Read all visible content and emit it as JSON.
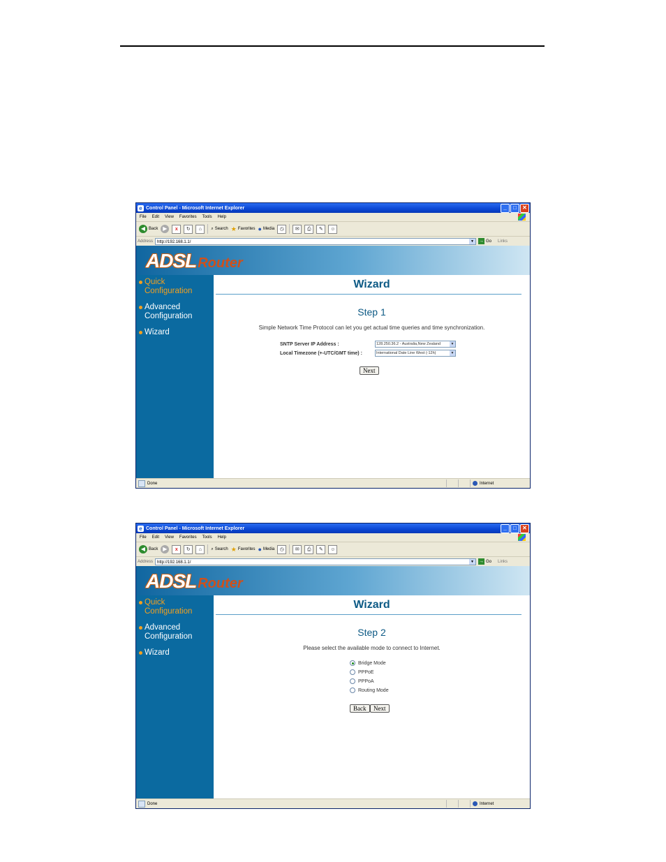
{
  "browser": {
    "window_title": "Control Panel - Microsoft Internet Explorer",
    "menu": [
      "File",
      "Edit",
      "View",
      "Favorites",
      "Tools",
      "Help"
    ],
    "toolbar": {
      "back": "Back",
      "search": "Search",
      "favorites": "Favorites",
      "media": "Media"
    },
    "address_label": "Address",
    "address_value": "http://192.168.1.1/",
    "go_label": "Go",
    "links_label": "Links",
    "status_text": "Done",
    "zone_text": "Internet"
  },
  "banner": {
    "logo_main": "ADSL",
    "logo_sub": "Router"
  },
  "sidebar": {
    "items": [
      {
        "line1": "Quick",
        "line2": "Configuration"
      },
      {
        "line1": "Advanced",
        "line2": "Configuration"
      },
      {
        "line1": "Wizard",
        "line2": ""
      }
    ]
  },
  "screens": [
    {
      "title": "Wizard",
      "step": "Step 1",
      "description": "Simple Network Time Protocol can let you get actual time queries and time synchronization.",
      "fields": [
        {
          "label": "SNTP Server IP Address :",
          "value": "128.250.36.2 - Australia,New Zealand"
        },
        {
          "label": "Local Timezone (+-UTC/GMT time) :",
          "value": "International Date Line West (-12h)"
        }
      ],
      "next_label": "Next"
    },
    {
      "title": "Wizard",
      "step": "Step 2",
      "description": "Please select the available mode to connect to Internet.",
      "options": [
        "Bridge Mode",
        "PPPoE",
        "PPPoA",
        "Routing Mode"
      ],
      "selected_option": "Bridge Mode",
      "back_label": "Back",
      "next_label": "Next"
    }
  ]
}
